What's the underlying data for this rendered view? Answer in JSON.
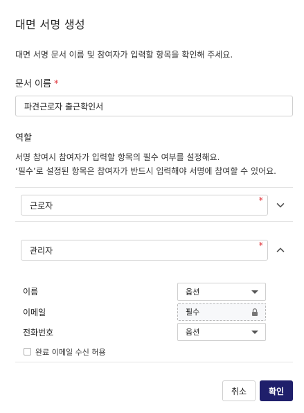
{
  "dialog": {
    "title": "대면 서명 생성",
    "description": "대면 서명 문서 이름 및 참여자가 입력할 항목을 확인해 주세요."
  },
  "document": {
    "label": "문서 이름",
    "required_mark": "*",
    "value": "파견근로자 출근확인서"
  },
  "roles": {
    "label": "역할",
    "desc_line1": "서명 참여시 참여자가 입력할 항목의 필수 여부를 설정해요.",
    "desc_line2": "‘필수’로 설정된 항목은 참여자가 반드시 입력해야 서명에 참여할 수 있어요.",
    "items": [
      {
        "name": "근로자",
        "required_mark": "*",
        "expanded": false
      },
      {
        "name": "관리자",
        "required_mark": "*",
        "expanded": true
      }
    ]
  },
  "fields": [
    {
      "label": "이름",
      "option": "옵션",
      "locked": false
    },
    {
      "label": "이메일",
      "option": "필수",
      "locked": true
    },
    {
      "label": "전화번호",
      "option": "옵션",
      "locked": false
    }
  ],
  "completion_email": {
    "label": "완료 이메일 수신 허용",
    "checked": false
  },
  "buttons": {
    "cancel": "취소",
    "confirm": "확인"
  },
  "colors": {
    "required": "#e0343b",
    "primary": "#1f1f6b"
  }
}
